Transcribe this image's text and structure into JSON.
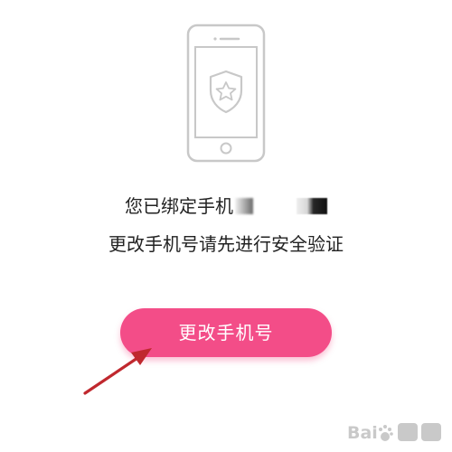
{
  "bound_text": "您已绑定手机",
  "verify_hint": "更改手机号请先进行安全验证",
  "change_button_label": "更改手机号",
  "colors": {
    "button": "#f34d88",
    "button_text": "#ffffff",
    "text": "#222222",
    "illustration_stroke": "#c8c8c8",
    "annotation_arrow": "#c0282e"
  },
  "icons": [
    "phone-illustration-icon",
    "shield-star-icon",
    "annotation-arrow-icon",
    "baidu-jingyan-watermark"
  ]
}
